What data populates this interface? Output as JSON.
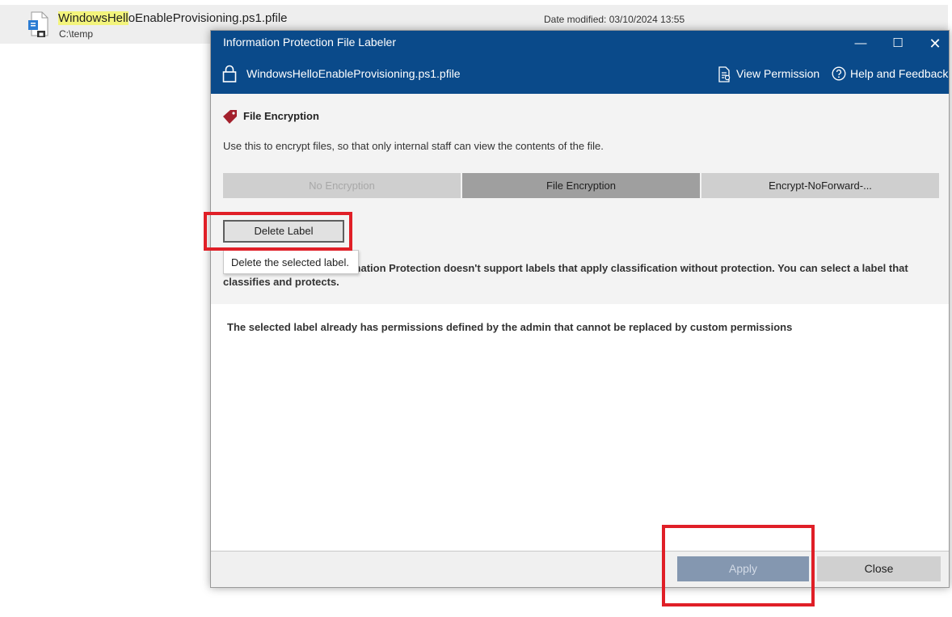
{
  "explorer_result": {
    "file_name_highlight": "WindowsHell",
    "file_name_rest": "oEnableProvisioning.ps1.pfile",
    "path": "C:\\temp",
    "date_modified": "Date modified: 03/10/2024 13:55"
  },
  "dialog": {
    "title": "Information Protection File Labeler",
    "window_controls": {
      "minimize": "—",
      "maximize": "☐",
      "close": "✕"
    },
    "document_name": "WindowsHelloEnableProvisioning.ps1.pfile",
    "view_permission_label": "View Permission",
    "help_label": "Help and Feedback",
    "label_heading": "File Encryption",
    "label_description": "Use this to encrypt files, so that only internal staff can view the contents of the file.",
    "label_options": [
      "No Encryption",
      "File Encryption",
      "Encrypt-NoForward-..."
    ],
    "selected_option_index": 1,
    "delete_button": "Delete Label",
    "tooltip": "Delete the selected label.",
    "info_message": "... Microsoft Purview Information Protection doesn't support labels that apply classification without protection.  You can select a label that classifies and protects.",
    "permissions_message": "The selected label already has permissions defined by the admin that cannot be replaced by custom permissions",
    "apply_button": "Apply",
    "close_button": "Close"
  },
  "colors": {
    "titlebar": "#0a4a8a",
    "annotation": "#e01f27",
    "apply_disabled": "#8497b0",
    "tag": "#a3202c"
  },
  "icons": [
    "file-icon",
    "lock-icon",
    "view-permission-icon",
    "help-icon",
    "tag-icon"
  ]
}
